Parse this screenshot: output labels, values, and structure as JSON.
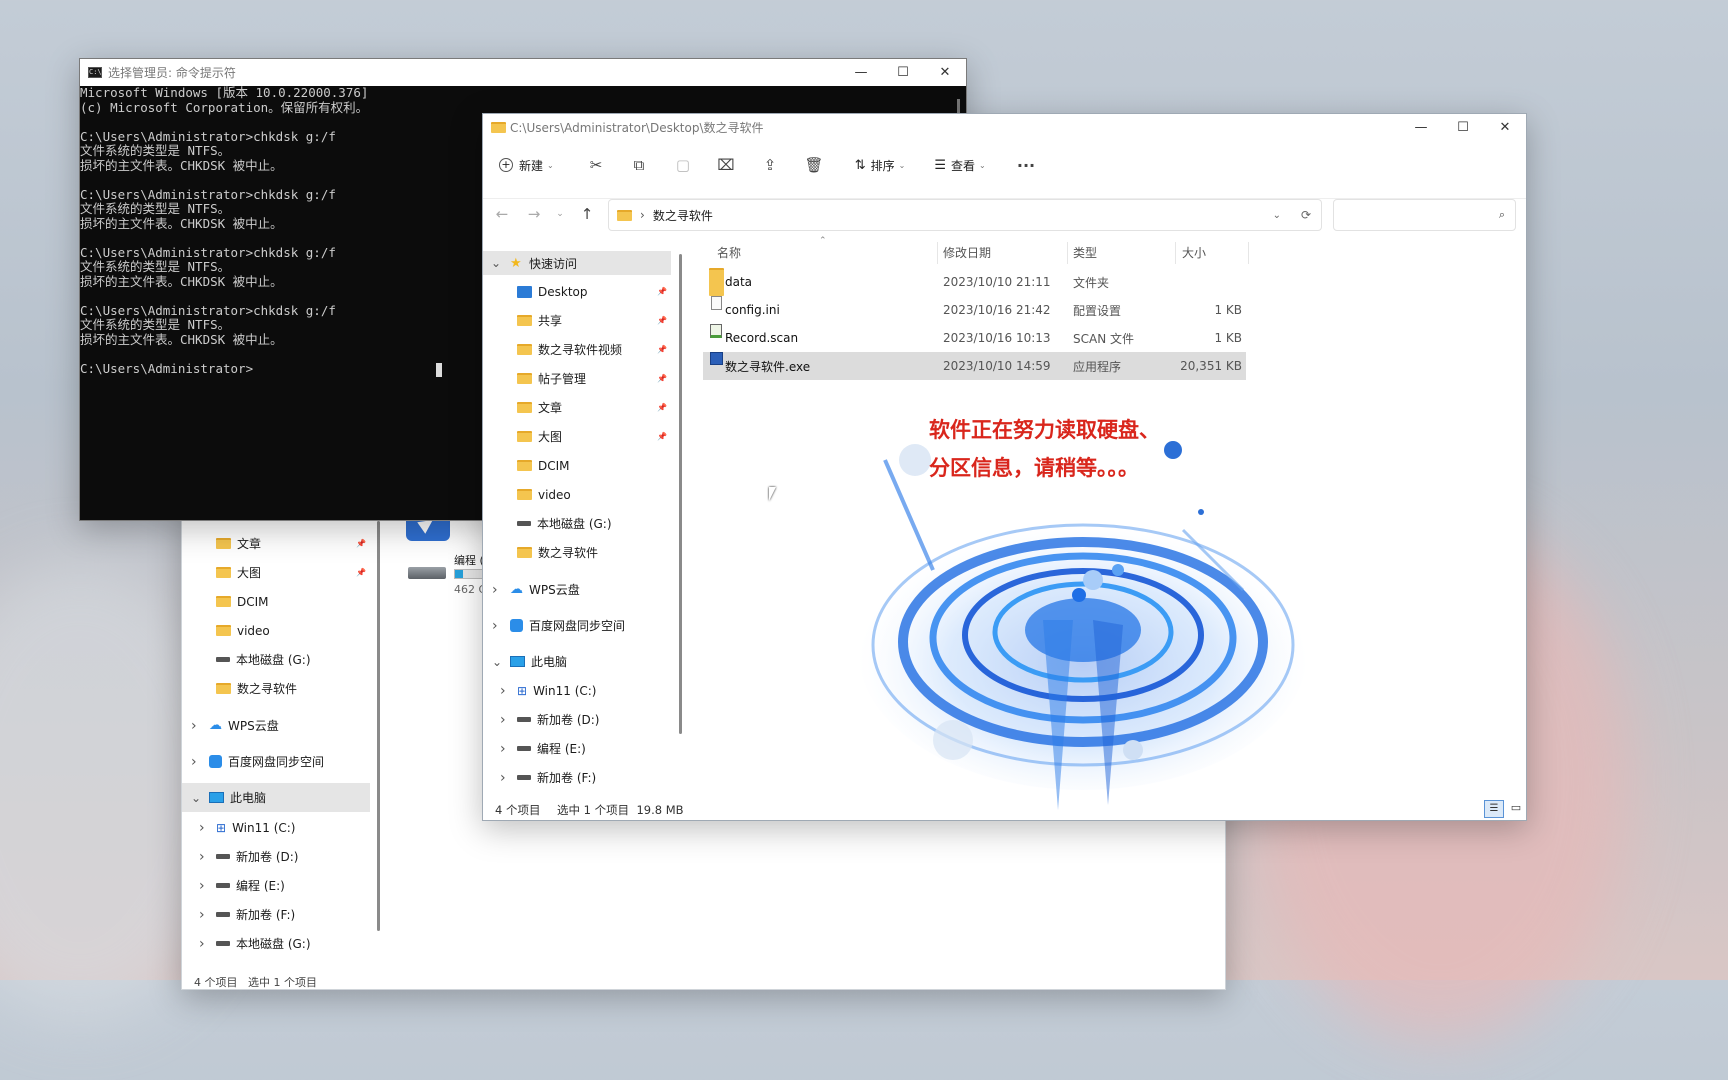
{
  "cmd": {
    "title": "选择管理员: 命令提示符",
    "lines": [
      "Microsoft Windows [版本 10.0.22000.376]",
      "(c) Microsoft Corporation。保留所有权利。",
      "",
      "C:\\Users\\Administrator>chkdsk g:/f",
      "文件系统的类型是 NTFS。",
      "损坏的主文件表。CHKDSK 被中止。",
      "",
      "C:\\Users\\Administrator>chkdsk g:/f",
      "文件系统的类型是 NTFS。",
      "损坏的主文件表。CHKDSK 被中止。",
      "",
      "C:\\Users\\Administrator>chkdsk g:/f",
      "文件系统的类型是 NTFS。",
      "损坏的主文件表。CHKDSK 被中止。",
      "",
      "C:\\Users\\Administrator>chkdsk g:/f",
      "文件系统的类型是 NTFS。",
      "损坏的主文件表。CHKDSK 被中止。",
      "",
      "C:\\Users\\Administrator>"
    ]
  },
  "bg_explorer": {
    "nav": [
      {
        "label": "文章",
        "icon": "folder-icon",
        "pinned": true
      },
      {
        "label": "大图",
        "icon": "folder-icon",
        "pinned": true
      },
      {
        "label": "DCIM",
        "icon": "folder-icon"
      },
      {
        "label": "video",
        "icon": "folder-icon"
      },
      {
        "label": "本地磁盘 (G:)",
        "icon": "drive-icon"
      },
      {
        "label": "数之寻软件",
        "icon": "folder-icon"
      }
    ],
    "groups": [
      {
        "label": "WPS云盘",
        "icon": "cloud-icon"
      },
      {
        "label": "百度网盘同步空间",
        "icon": "baidu-icon"
      },
      {
        "label": "此电脑",
        "icon": "pc-icon"
      }
    ],
    "drives": [
      "Win11 (C:)",
      "新加卷 (D:)",
      "编程 (E:)",
      "新加卷 (F:)",
      "本地磁盘 (G:)"
    ],
    "drive_label": "编程 (",
    "drive_size": "462 G",
    "status": "4 个项目   选中 1 个项目"
  },
  "explorer": {
    "title": "C:\\Users\\Administrator\\Desktop\\数之寻软件",
    "toolbar": {
      "new_label": "新建",
      "sort_label": "排序",
      "view_label": "查看",
      "more": "···"
    },
    "breadcrumb": "数之寻软件",
    "search_placeholder": "",
    "quick_access": "快速访问",
    "nav": [
      {
        "label": "Desktop",
        "icon": "desktop-icon",
        "pinned": true
      },
      {
        "label": "共享",
        "icon": "folder-icon",
        "pinned": true
      },
      {
        "label": "数之寻软件视频",
        "icon": "folder-icon",
        "pinned": true
      },
      {
        "label": "帖子管理",
        "icon": "folder-icon",
        "pinned": true
      },
      {
        "label": "文章",
        "icon": "folder-icon",
        "pinned": true
      },
      {
        "label": "大图",
        "icon": "folder-icon",
        "pinned": true
      },
      {
        "label": "DCIM",
        "icon": "folder-icon"
      },
      {
        "label": "video",
        "icon": "folder-icon"
      },
      {
        "label": "本地磁盘 (G:)",
        "icon": "drive-icon"
      },
      {
        "label": "数之寻软件",
        "icon": "folder-icon"
      }
    ],
    "groups": [
      {
        "label": "WPS云盘",
        "icon": "cloud-icon"
      },
      {
        "label": "百度网盘同步空间",
        "icon": "baidu-icon"
      },
      {
        "label": "此电脑",
        "icon": "pc-icon"
      }
    ],
    "drives": [
      "Win11 (C:)",
      "新加卷 (D:)",
      "编程 (E:)",
      "新加卷 (F:)"
    ],
    "columns": {
      "name": "名称",
      "date": "修改日期",
      "type": "类型",
      "size": "大小"
    },
    "files": [
      {
        "name": "data",
        "date": "2023/10/10 21:11",
        "type": "文件夹",
        "size": "",
        "icon": "folder-icon"
      },
      {
        "name": "config.ini",
        "date": "2023/10/16 21:42",
        "type": "配置设置",
        "size": "1 KB",
        "icon": "ini-file-icon"
      },
      {
        "name": "Record.scan",
        "date": "2023/10/16 10:13",
        "type": "SCAN 文件",
        "size": "1 KB",
        "icon": "scan-file-icon"
      },
      {
        "name": "数之寻软件.exe",
        "date": "2023/10/10 14:59",
        "type": "应用程序",
        "size": "20,351 KB",
        "icon": "exe-icon",
        "selected": true
      }
    ],
    "status_count": "4 个项目",
    "status_selected": "选中 1 个项目  19.8 MB",
    "overlay_line1": "软件正在努力读取硬盘、",
    "overlay_line2": "分区信息，请稍等。。。"
  }
}
